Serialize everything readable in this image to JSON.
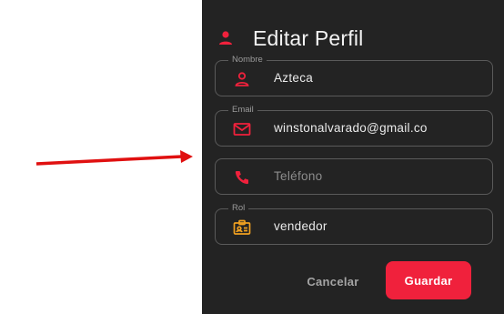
{
  "dialog": {
    "title": "Editar Perfil",
    "accent_color": "#f0213c",
    "fields": [
      {
        "legend": "Nombre",
        "value": "Azteca",
        "icon": "person-icon"
      },
      {
        "legend": "Email",
        "value": "winstonalvarado@gmail.co",
        "icon": "mail-icon"
      },
      {
        "legend": "",
        "placeholder": "Teléfono",
        "icon": "phone-icon"
      },
      {
        "legend": "Rol",
        "value": "vendedor",
        "icon": "id-badge-icon"
      }
    ],
    "cancel_label": "Cancelar",
    "save_label": "Guardar"
  },
  "annotation": {
    "arrow_color": "#e01010",
    "arrow": "red-arrow-pointing-right"
  }
}
